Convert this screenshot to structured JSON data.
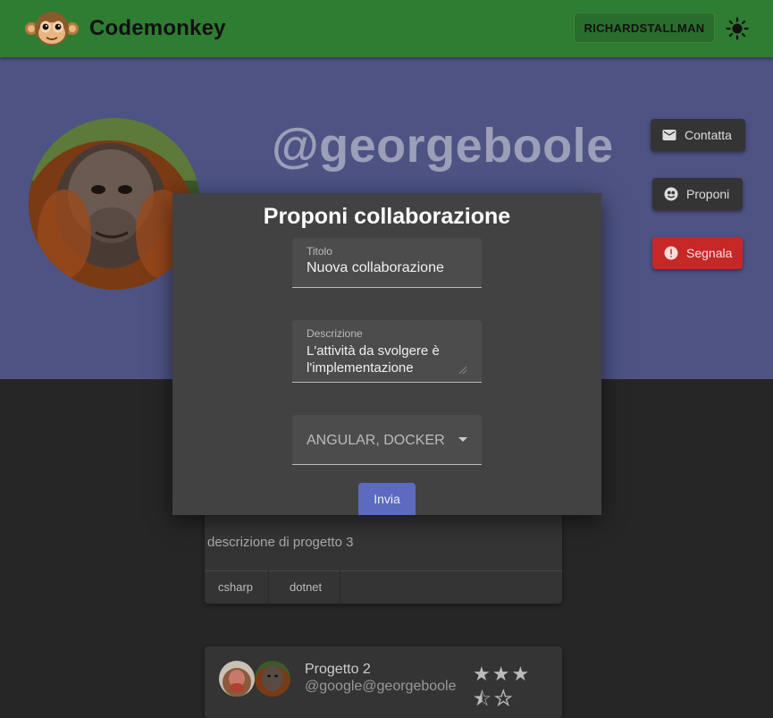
{
  "header": {
    "brand": "Codemonkey",
    "user_button": "RICHARDSTALLMAN",
    "logo_icon": "monkey-logo-icon",
    "theme_icon": "sun-icon",
    "bg_color": "#2e7d32"
  },
  "profile": {
    "username": "@georgeboole",
    "avatar": "orangutan-avatar",
    "bg_color": "#4e5384",
    "actions": [
      {
        "label": "Contatta",
        "icon": "mail-icon"
      },
      {
        "label": "Proponi",
        "icon": "handshake-icon"
      },
      {
        "label": "Segnala",
        "icon": "alert-icon",
        "color": "#c62828"
      }
    ]
  },
  "projects": [
    {
      "description": "descrizione di progetto 3",
      "tags": [
        "csharp",
        "dotnet"
      ]
    },
    {
      "name": "Progetto 2",
      "owner": "@google@georgeboole",
      "rating_filled": 3.5,
      "rating_max": 5
    }
  ],
  "dialog": {
    "title": "Proponi collaborazione",
    "title_field": {
      "label": "Titolo",
      "value": "Nuova collaborazione"
    },
    "description_field": {
      "label": "Descrizione",
      "value": "L'attività da svolgere è l'implementazione"
    },
    "technologies_select": {
      "value": "ANGULAR, DOCKER"
    },
    "submit_label": "Invia",
    "submit_color": "#5c6bc0"
  }
}
